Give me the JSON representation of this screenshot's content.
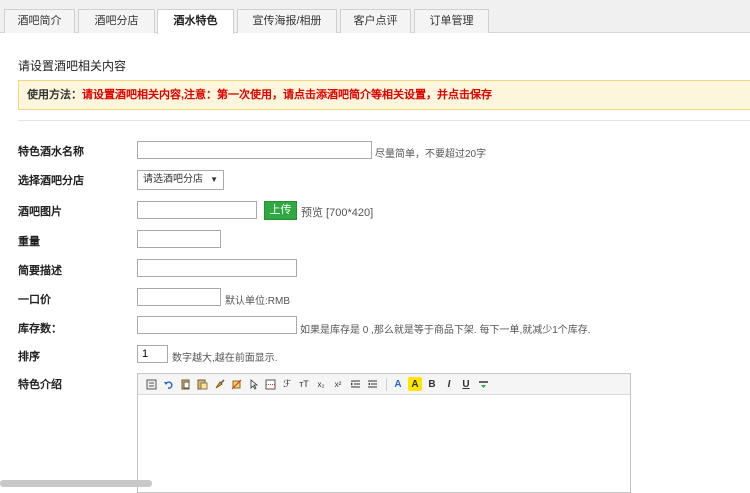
{
  "tabs": [
    {
      "label": "酒吧简介"
    },
    {
      "label": "酒吧分店"
    },
    {
      "label": "酒水特色"
    },
    {
      "label": "宣传海报/相册"
    },
    {
      "label": "客户点评"
    },
    {
      "label": "订单管理"
    }
  ],
  "active_tab": "酒水特色",
  "page_heading": "请设置酒吧相关内容",
  "notice": {
    "label": "使用方法：",
    "message": "请设置酒吧相关内容,注意：第一次使用，请点击添酒吧简介等相关设置，并点击保存"
  },
  "form": {
    "name": {
      "label": "特色酒水名称",
      "value": "",
      "hint": "尽量简单，不要超过20字"
    },
    "branch": {
      "label": "选择酒吧分店",
      "selected": "请选酒吧分店"
    },
    "image": {
      "label": "酒吧图片",
      "value": "",
      "upload_label": "上传",
      "preview_hint": "预览 [700*420]"
    },
    "weight": {
      "label": "重量",
      "value": ""
    },
    "summary": {
      "label": "简要描述",
      "value": ""
    },
    "price": {
      "label": "一口价",
      "value": "",
      "hint": "默认单位:RMB"
    },
    "stock": {
      "label": "库存数：",
      "value": "",
      "hint": "如果是库存是 0 ,那么就是等于商品下架. 每下一单,就减少1个库存."
    },
    "sort": {
      "label": "排序",
      "value": "1",
      "hint": "数字越大,越在前面显示."
    },
    "intro": {
      "label": "特色介绍"
    }
  },
  "editor_toolbar": {
    "bold": "B",
    "italic": "I",
    "underline": "U",
    "superscript": "x²",
    "subscript": "x₂",
    "font_color": "A",
    "highlight": "A",
    "font_family": "ℱ",
    "font_size": "тT"
  },
  "colors": {
    "notice_bg": "#fdf6dd",
    "notice_text": "#e00000",
    "upload_button": "#2ea840"
  }
}
